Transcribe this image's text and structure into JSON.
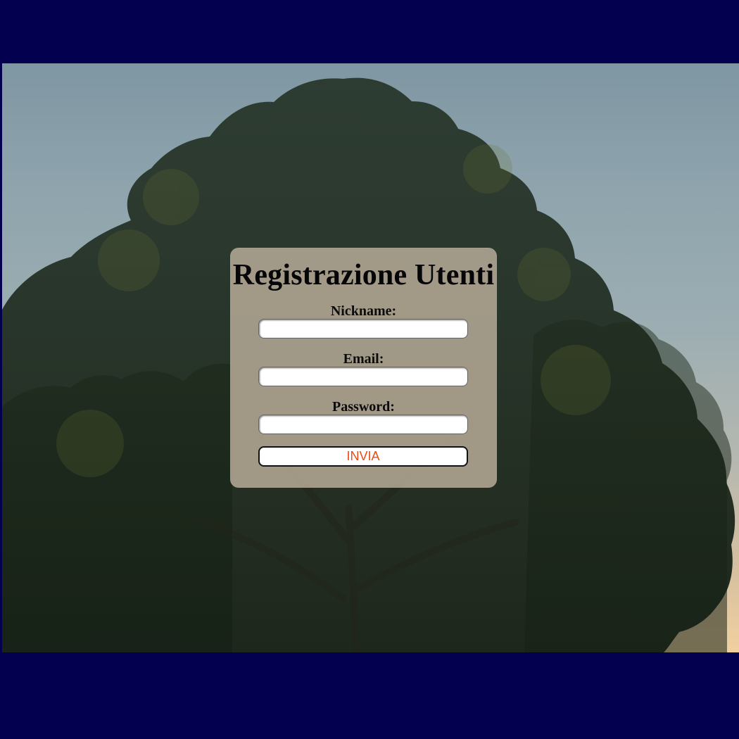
{
  "page": {
    "background_color": "#02004f",
    "hero_image_icon": "tree-photo"
  },
  "form": {
    "title": "Registrazione Utenti",
    "fields": [
      {
        "label": "Nickname:",
        "value": "",
        "placeholder": ""
      },
      {
        "label": "Email:",
        "value": "",
        "placeholder": ""
      },
      {
        "label": "Password:",
        "value": "",
        "placeholder": ""
      }
    ],
    "submit_label": "INVIA"
  },
  "colors": {
    "panel": "#c4b6a2",
    "button_text": "#f04a14"
  }
}
